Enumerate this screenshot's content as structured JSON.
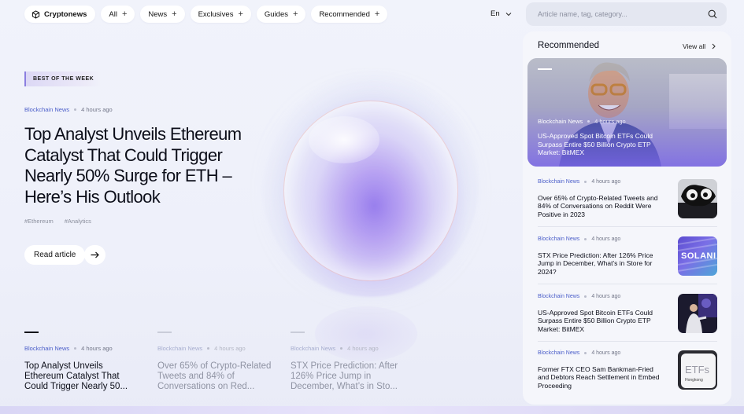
{
  "nav": {
    "brand": "Cryptonews",
    "items": [
      {
        "label": "All"
      },
      {
        "label": "News"
      },
      {
        "label": "Exclusives"
      },
      {
        "label": "Guides"
      },
      {
        "label": "Recommended"
      }
    ],
    "language": "En",
    "search_placeholder": "Article name, tag, category..."
  },
  "hero": {
    "badge": "BEST OF THE WEEK",
    "category": "Blockchain News",
    "time": "4 hours ago",
    "title": "Top Analyst Unveils Ethereum Catalyst That Could Trigger Nearly 50% Surge for ETH – Here’s His Outlook",
    "tags": [
      "#Ethereum",
      "#Analytics"
    ],
    "cta": "Read article"
  },
  "strip": [
    {
      "category": "Blockchain News",
      "time": "4 hours ago",
      "title": "Top Analyst Unveils Ethereum Catalyst That Could Trigger Nearly 50..."
    },
    {
      "category": "Blockchain News",
      "time": "4 hours ago",
      "title": "Over 65% of Crypto-Related Tweets and 84% of Conversations on Red..."
    },
    {
      "category": "Blockchain News",
      "time": "4 hours ago",
      "title": "STX Price Prediction: After 126% Price Jump in December, What’s in Sto..."
    }
  ],
  "sidebar": {
    "heading": "Recommended",
    "view_all": "View all",
    "featured": {
      "category": "Blockchain News",
      "time": "4 hours ago",
      "title": "US-Approved Spot Bitcoin ETFs Could Surpass Entire $50 Billion Crypto ETP Market: BitMEX"
    },
    "items": [
      {
        "category": "Blockchain News",
        "time": "4 hours ago",
        "title": "Over 65% of Crypto-Related Tweets and 84% of Conversations on Reddit Were Positive in 2023"
      },
      {
        "category": "Blockchain News",
        "time": "4 hours ago",
        "title": "STX Price Prediction: After 126% Price Jump in December, What’s in Store for 2024?",
        "thumb_text": "SOLANI"
      },
      {
        "category": "Blockchain News",
        "time": "4 hours ago",
        "title": "US-Approved Spot Bitcoin ETFs Could Surpass Entire $50 Billion Crypto ETP Market: BitMEX"
      },
      {
        "category": "Blockchain News",
        "time": "4 hours ago",
        "title": "Former FTX CEO Sam Bankman-Fried and Debtors Reach Settlement in Embed Proceeding",
        "thumb_text": "ETFs",
        "thumb_subtext": "Hongkong"
      }
    ]
  },
  "colors": {
    "accent": "#4b5ec9",
    "feature_gradient_end": "#7a64e6"
  }
}
